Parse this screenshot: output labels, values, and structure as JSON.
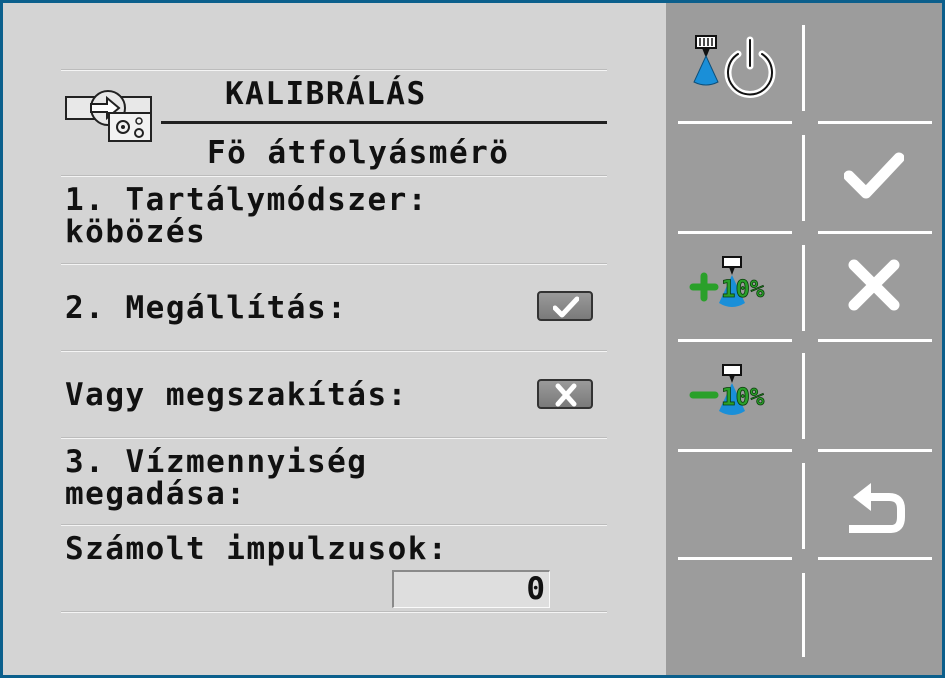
{
  "screen": {
    "title": "KALIBRÁLÁS",
    "subtitle": "Fö átfolyásmérö",
    "step1_line1": "1. Tartálymódszer:",
    "step1_line2": "köbözés",
    "step2_label": "2. Megállítás:",
    "abort_label": "Vagy megszakítás:",
    "step3_line1": "3. Vízmennyiség",
    "step3_line2": "megadása:",
    "pulses_label": "Számolt impulzusok:",
    "pulses_value": "0"
  },
  "softkeys": {
    "plus_percent": "10%",
    "minus_percent": "10%"
  },
  "colors": {
    "frame": "#0b5f8c",
    "panel": "#d4d4d4",
    "keys_bg": "#9c9c9c",
    "water_blue": "#1a8fd8",
    "green": "#2aa02a"
  }
}
